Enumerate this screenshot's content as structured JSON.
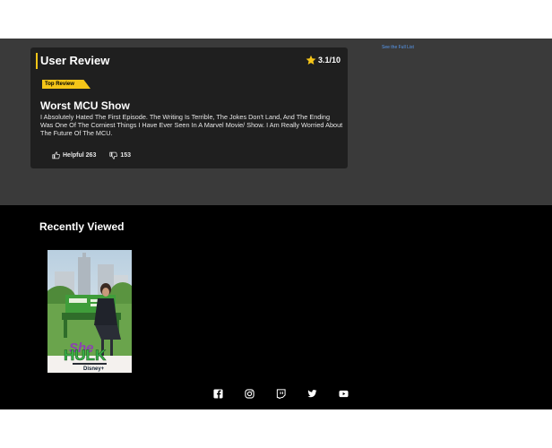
{
  "review": {
    "section_title": "User Review",
    "rating": "3.1/10",
    "badge": "Top Review",
    "heading": "Worst MCU Show",
    "body": "I Absolutely Hated The First Episode. The Writing Is Terrible, The Jokes Don't Land, And The Ending Was One Of The Corniest Things I Have Ever Seen In A Marvel Movie/ Show. I Am Really Worried About The Future Of The MCU.",
    "helpful_label": "Helpful 263",
    "not_helpful_count": "153",
    "full_list_link": "See the Full List"
  },
  "recent": {
    "title": "Recently Viewed",
    "poster_alt": "She-Hulk Attorney at Law poster"
  },
  "social": [
    "facebook-icon",
    "instagram-icon",
    "twitch-icon",
    "twitter-icon",
    "youtube-icon"
  ],
  "colors": {
    "accent": "#f5c518",
    "review_bg": "#3a3a3a",
    "card_bg": "#1f1f1f",
    "footer_bg": "#000000",
    "link": "#5799ef"
  }
}
